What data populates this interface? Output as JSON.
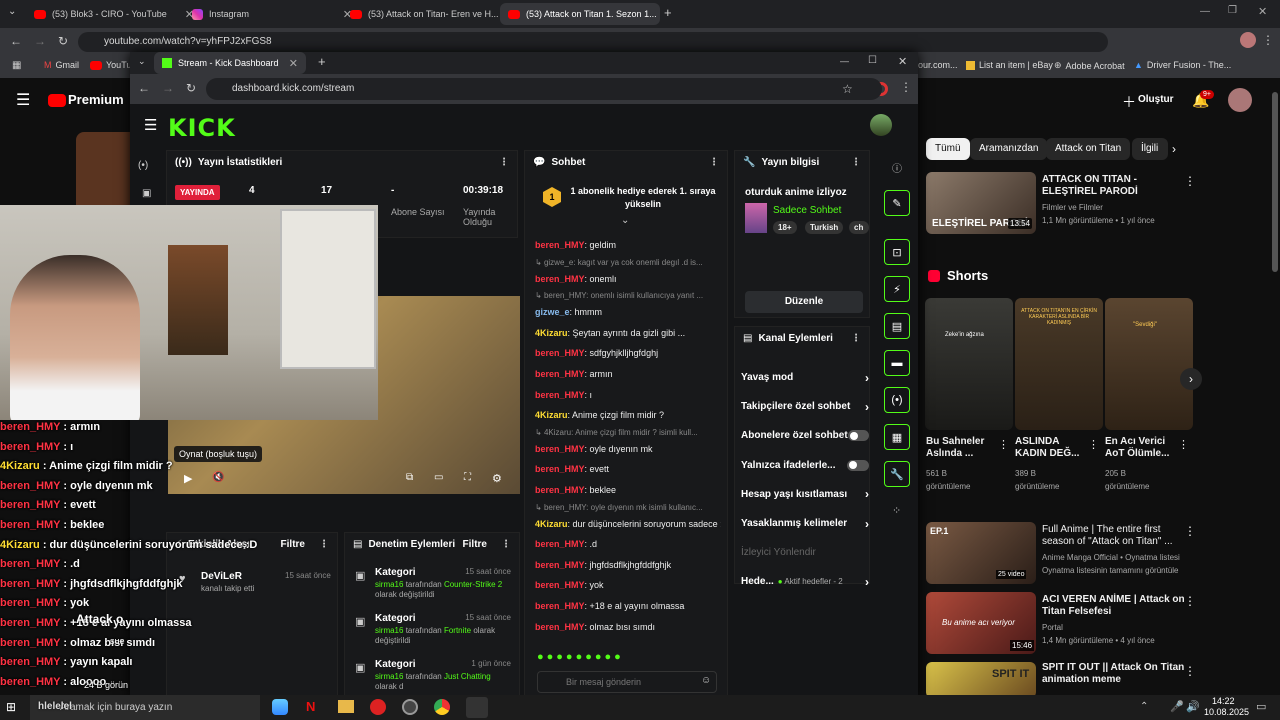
{
  "outer_tabs": [
    {
      "title": "(53) Blok3 - CIRO - YouTube"
    },
    {
      "title": "Instagram"
    },
    {
      "title": "(53) Attack on Titan- Eren ve H..."
    },
    {
      "title": "(53) Attack on Titan 1. Sezon 1..."
    }
  ],
  "outer_url": "youtube.com/watch?v=yhFPJ2xFGS8",
  "bookmarks": [
    "Gmail",
    "YouTu",
    "our.com...",
    "List an item | eBay",
    "Adobe Acrobat",
    "Driver Fusion - The..."
  ],
  "yt": {
    "premium": "Premium",
    "create": "Oluştur",
    "notif_badge": "9+",
    "chips": [
      "Tümü",
      "Aramanızdan",
      "Attack on Titan",
      "İlgili"
    ],
    "top_video": {
      "title": "ATTACK ON TITAN - ELEŞTİREL PARODİ",
      "channel": "Filmler ve Filmler",
      "meta": "1,1 Mn görüntüleme • 1 yıl önce",
      "duration": "13:54",
      "thumb_text": "ELEŞTİREL PARODİ"
    },
    "shorts_title": "Shorts",
    "shorts": [
      {
        "title": "Bu Sahneler Aslında ...",
        "views": "561 B",
        "views_label": "görüntüleme",
        "overlay": "Zeke'in ağzına"
      },
      {
        "title": "ASLINDA KADIN DEĞ...",
        "views": "389 B",
        "views_label": "görüntüleme",
        "overlay": "ATTACK ON TITAN'IN EN ÇİRKİN KARAKTERİ ASLINDA BİR KADINMIŞ"
      },
      {
        "title": "En Acı Verici AoT Ölümle...",
        "views": "205 B",
        "views_label": "görüntüleme",
        "overlay": "\"Sevdiği\""
      }
    ],
    "videos": [
      {
        "title": "Full Anime | The entire first season of \"Attack on Titan\" ...",
        "channel": "Anime Manga Official • Oynatma listesi",
        "meta": "Oynatma listesinin tamamını görüntüle",
        "badge": "25 video",
        "thumb_text": "EP.1"
      },
      {
        "title": "ACI VEREN ANİME | Attack on Titan Felsefesi",
        "channel": "Portal",
        "meta": "1,4 Mn görüntüleme • 4 yıl önce",
        "duration": "15:46",
        "thumb_text": "Bu anime acı veriyor"
      },
      {
        "title": "SPIT IT OUT || Attack On Titan animation meme",
        "channel": "",
        "meta": "",
        "thumb_text": "SPIT IT"
      }
    ]
  },
  "kick": {
    "tab_title": "Stream - Kick Dashboard",
    "url": "dashboard.kick.com/stream",
    "logo": "KICK",
    "stats": {
      "title": "Yayın İstatistikleri",
      "live_badge": "YAYINDA",
      "v1": "4",
      "v2": "17",
      "v3": "-",
      "v3_label": "Abone Sayısı",
      "v4": "00:39:18",
      "v4_label": "Yayında Olduğu"
    },
    "player_tooltip": "Oynat (boşluk tuşu)",
    "activity": {
      "title": "Etkinlik Akışı",
      "filter": "Filtre",
      "user": "DeViLeR",
      "action": "kanalı takip etti",
      "time": "15 saat önce"
    },
    "moderation": {
      "title": "Denetim Eylemleri",
      "filter": "Filtre",
      "items": [
        {
          "title": "Kategori",
          "time": "15 saat önce",
          "user": "sirma16",
          "mid": "tarafından",
          "value": "Counter-Strike 2",
          "end": "olarak değiştirildi"
        },
        {
          "title": "Kategori",
          "time": "15 saat önce",
          "user": "sirma16",
          "mid": "tarafından",
          "value": "Fortnite",
          "end": "olarak değiştirildi"
        },
        {
          "title": "Kategori",
          "time": "1 gün önce",
          "user": "sirma16",
          "mid": "tarafından",
          "value": "Just Chatting",
          "end": "olarak d"
        }
      ]
    },
    "chat": {
      "title": "Sohbet",
      "pinned": "1 abonelik hediye ederek 1. sıraya yükselin",
      "pinned_num": "1",
      "input_placeholder": "Bir mesaj gönderin",
      "messages": [
        {
          "type": "msg",
          "user": "beren_HMY",
          "text": "geldim",
          "c": "r"
        },
        {
          "type": "reply",
          "text": "gizwe_e: kagıt var ya cok onemli degıl .d is..."
        },
        {
          "type": "msg",
          "user": "beren_HMY",
          "text": "onemlı",
          "c": "r"
        },
        {
          "type": "reply",
          "text": "beren_HMY: onemlı isimli kullanıcıya yanıt ..."
        },
        {
          "type": "msg",
          "user": "gizwe_e",
          "text": "hmmm",
          "c": "b"
        },
        {
          "type": "msg",
          "user": "4Kizaru",
          "text": "Şeytan ayrıntı da gizli gibi ...",
          "c": "y"
        },
        {
          "type": "msg",
          "user": "beren_HMY",
          "text": "sdfgyhjklljhgfdghj",
          "c": "r"
        },
        {
          "type": "msg",
          "user": "beren_HMY",
          "text": "armın",
          "c": "r"
        },
        {
          "type": "msg",
          "user": "beren_HMY",
          "text": "ı",
          "c": "r"
        },
        {
          "type": "msg",
          "user": "4Kizaru",
          "text": "Anime çizgi film midir ?",
          "c": "y"
        },
        {
          "type": "reply",
          "text": "4Kizaru: Anime çizgi film midir ? isimli kull..."
        },
        {
          "type": "msg",
          "user": "beren_HMY",
          "text": "oyle dıyenın mk",
          "c": "r"
        },
        {
          "type": "msg",
          "user": "beren_HMY",
          "text": "evett",
          "c": "r"
        },
        {
          "type": "msg",
          "user": "beren_HMY",
          "text": "beklee",
          "c": "r"
        },
        {
          "type": "reply",
          "text": "beren_HMY: oyle dıyenın mk isimli kullanıc..."
        },
        {
          "type": "msg",
          "user": "4Kizaru",
          "text": "dur düşüncelerini soruyorum sadece :D",
          "c": "y"
        },
        {
          "type": "msg",
          "user": "beren_HMY",
          "text": ".d",
          "c": "r"
        },
        {
          "type": "msg",
          "user": "beren_HMY",
          "text": "jhgfdsdflkjhgfddfghjk",
          "c": "r"
        },
        {
          "type": "msg",
          "user": "beren_HMY",
          "text": "yok",
          "c": "r"
        },
        {
          "type": "msg",
          "user": "beren_HMY",
          "text": "+18 e al yayını olmassa",
          "c": "r"
        },
        {
          "type": "msg",
          "user": "beren_HMY",
          "text": "olmaz bısı sımdı",
          "c": "r"
        }
      ]
    },
    "info": {
      "title": "Yayın bilgisi",
      "stream_title": "oturduk anime izliyoz",
      "category": "Sadece Sohbet",
      "tags": [
        "18+",
        "Turkish",
        "ch"
      ],
      "edit": "Düzenle"
    },
    "channel_actions": {
      "title": "Kanal Eylemleri",
      "rows": [
        {
          "label": "Yavaş mod",
          "kind": "chev"
        },
        {
          "label": "Takipçilere özel sohbet",
          "kind": "chev"
        },
        {
          "label": "Abonelere özel sohbet",
          "kind": "toggle"
        },
        {
          "label": "Yalnızca ifadelerle...",
          "kind": "toggle"
        },
        {
          "label": "Hesap yaşı kısıtlaması",
          "kind": "chev"
        },
        {
          "label": "Yasaklanmış kelimeler",
          "kind": "chev"
        },
        {
          "label": "İzleyici Yönlendir",
          "kind": "muted"
        },
        {
          "label": "Hede...",
          "kind": "active",
          "extra": "Aktif hedefler - 2"
        }
      ]
    }
  },
  "overlay_chat": [
    {
      "user": "beren_HMY",
      "text": ": armın",
      "c": "r"
    },
    {
      "user": "beren_HMY",
      "text": ": ı",
      "c": "r"
    },
    {
      "user": "4Kizaru",
      "text": ": Anime çizgi film midir ?",
      "c": "y"
    },
    {
      "user": "beren_HMY",
      "text": ": oyle dıyenın mk",
      "c": "r"
    },
    {
      "user": "beren_HMY",
      "text": ": evett",
      "c": "r"
    },
    {
      "user": "beren_HMY",
      "text": ": beklee",
      "c": "r"
    },
    {
      "user": "4Kizaru",
      "text": ": dur düşüncelerini soruyorum sadece :D",
      "c": "y"
    },
    {
      "user": "beren_HMY",
      "text": ": .d",
      "c": "r"
    },
    {
      "user": "beren_HMY",
      "text": ": jhgfdsdflkjhgfddfghjk",
      "c": "r"
    },
    {
      "user": "beren_HMY",
      "text": ": yok",
      "c": "r"
    },
    {
      "user": "beren_HMY",
      "text": ": +18 e al yayını olmassa",
      "c": "r"
    },
    {
      "user": "beren_HMY",
      "text": ": olmaz bısı sımdı",
      "c": "r"
    },
    {
      "user": "beren_HMY",
      "text": ": yayın kapalı",
      "c": "r"
    },
    {
      "user": "beren_HMY",
      "text": ": aloooo",
      "c": "r"
    }
  ],
  "overlay_misc": {
    "attack": "Attack o",
    "sue": "sue",
    "view": "24 B görün",
    "last": "hlelelel"
  },
  "taskbar": {
    "search": "Aramak için buraya yazın",
    "time": "14:22",
    "date": "10.08.2025"
  },
  "colors": {
    "kick_green": "#53fc18",
    "live_red": "#e0203a"
  }
}
